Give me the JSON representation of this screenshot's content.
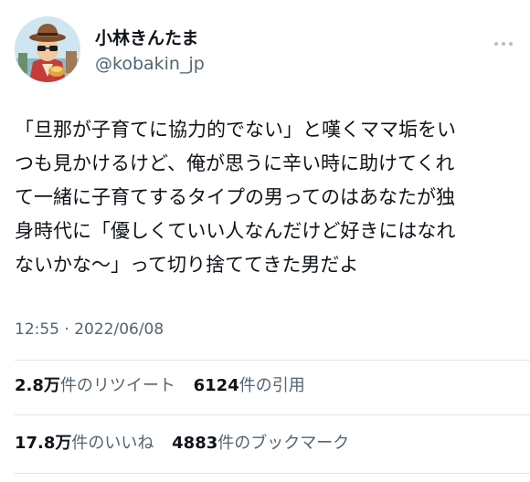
{
  "user": {
    "display_name": "小林きんたま",
    "handle": "@kobakin_jp"
  },
  "tweet": {
    "lines": [
      "「旦那が子育てに協力的でない」と嘆くママ垢をい",
      "つも見かけるけど、俺が思うに辛い時に助けてくれ",
      "て一緒に子育てするタイプの男ってのはあなたが独",
      "身時代に「優しくていい人なんだけど好きにはなれ",
      "ないかな〜」って切り捨ててきた男だよ"
    ],
    "timestamp": "12:55 · 2022/06/08"
  },
  "stats": {
    "retweets": {
      "num": "2.8",
      "unit": "万",
      "label": "件のリツイート"
    },
    "quotes": {
      "num": "6124",
      "unit": "",
      "label": "件の引用"
    },
    "likes": {
      "num": "17.8",
      "unit": "万",
      "label": "件のいいね"
    },
    "bookmarks": {
      "num": "4883",
      "unit": "",
      "label": "件のブックマーク"
    }
  },
  "icons": {
    "more": "more-horizontal-icon",
    "avatar": "user-avatar-illustration"
  }
}
